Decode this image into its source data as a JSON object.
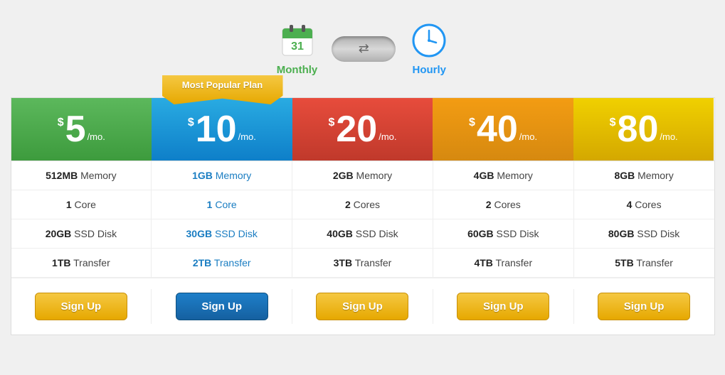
{
  "toggle": {
    "monthly_label": "Monthly",
    "hourly_label": "Hourly"
  },
  "popular_banner": "Most Popular Plan",
  "plans": [
    {
      "id": "plan-5",
      "price": "5",
      "period": "/mo.",
      "color_class": "green",
      "memory": "512MB",
      "cores": "1",
      "disk": "20GB",
      "transfer": "1TB",
      "highlighted": false
    },
    {
      "id": "plan-10",
      "price": "10",
      "period": "/mo.",
      "color_class": "blue",
      "memory": "1GB",
      "cores": "1",
      "disk": "30GB",
      "transfer": "2TB",
      "highlighted": true
    },
    {
      "id": "plan-20",
      "price": "20",
      "period": "/mo.",
      "color_class": "orange",
      "memory": "2GB",
      "cores": "2",
      "disk": "40GB",
      "transfer": "3TB",
      "highlighted": false
    },
    {
      "id": "plan-40",
      "price": "40",
      "period": "/mo.",
      "color_class": "amber",
      "memory": "4GB",
      "cores": "2",
      "disk": "60GB",
      "transfer": "4TB",
      "highlighted": false
    },
    {
      "id": "plan-80",
      "price": "80",
      "period": "/mo.",
      "color_class": "yellow",
      "memory": "8GB",
      "cores": "4",
      "disk": "80GB",
      "transfer": "5TB",
      "highlighted": false
    }
  ],
  "signup_button_label": "Sign Up",
  "feature_labels": {
    "memory": "Memory",
    "core": "Core",
    "cores": "Cores",
    "ssd_disk": "SSD Disk",
    "transfer": "Transfer"
  }
}
